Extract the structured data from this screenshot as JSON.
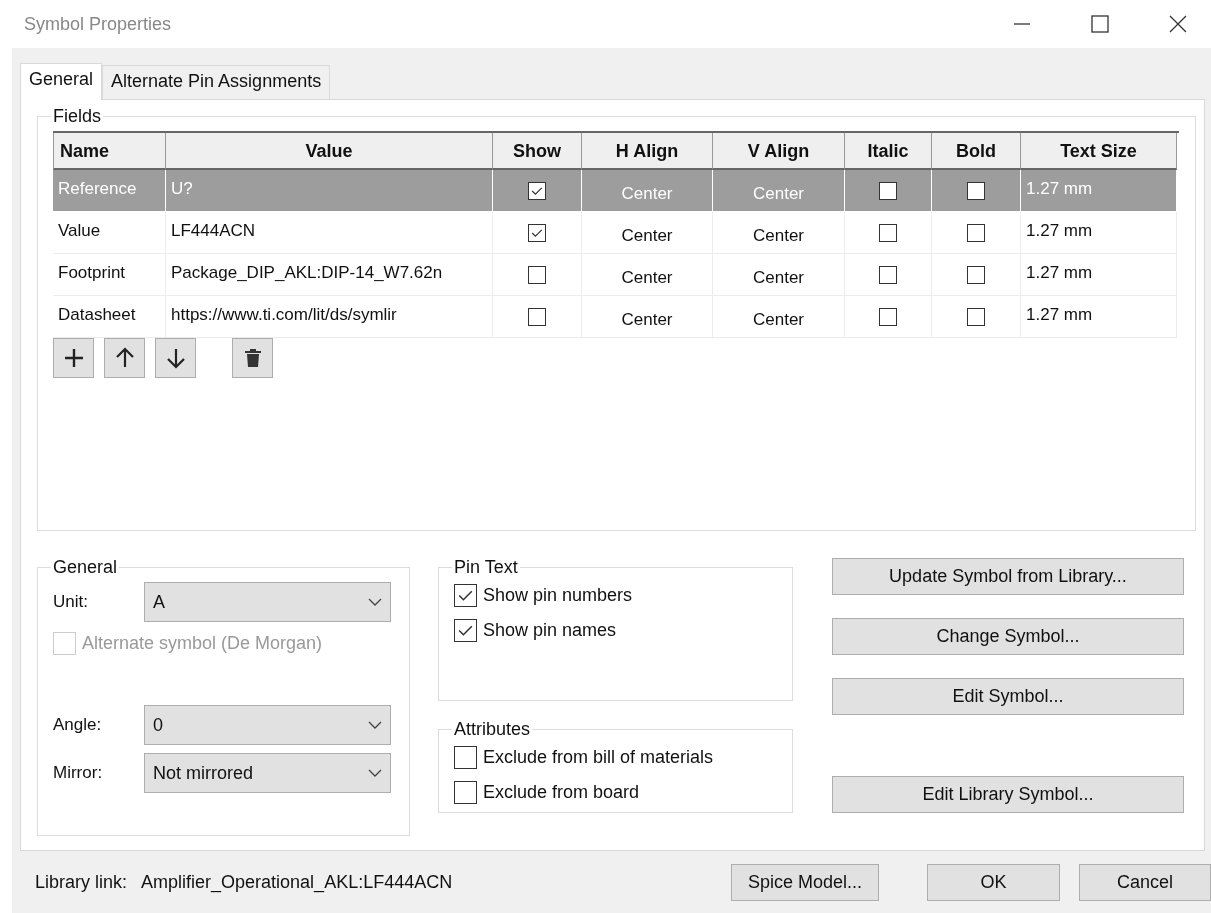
{
  "window": {
    "title": "Symbol Properties"
  },
  "tabs": [
    {
      "label": "General",
      "selected": true
    },
    {
      "label": "Alternate Pin Assignments",
      "selected": false
    }
  ],
  "fields": {
    "title": "Fields",
    "columns": [
      "Name",
      "Value",
      "Show",
      "H Align",
      "V Align",
      "Italic",
      "Bold",
      "Text Size"
    ],
    "rows": [
      {
        "name": "Reference",
        "value": "U?",
        "show": true,
        "h_align": "Center",
        "v_align": "Center",
        "italic": false,
        "bold": false,
        "text_size": "1.27 mm",
        "selected": true
      },
      {
        "name": "Value",
        "value": "LF444ACN",
        "show": true,
        "h_align": "Center",
        "v_align": "Center",
        "italic": false,
        "bold": false,
        "text_size": "1.27 mm",
        "selected": false
      },
      {
        "name": "Footprint",
        "value": "Package_DIP_AKL:DIP-14_W7.62n",
        "show": false,
        "h_align": "Center",
        "v_align": "Center",
        "italic": false,
        "bold": false,
        "text_size": "1.27 mm",
        "selected": false
      },
      {
        "name": "Datasheet",
        "value": "https://www.ti.com/lit/ds/symlir",
        "show": false,
        "h_align": "Center",
        "v_align": "Center",
        "italic": false,
        "bold": false,
        "text_size": "1.27 mm",
        "selected": false
      }
    ],
    "tools": [
      {
        "kind": "add"
      },
      {
        "kind": "up"
      },
      {
        "kind": "down"
      },
      {
        "kind": "delete"
      }
    ]
  },
  "general": {
    "title": "General",
    "unit": {
      "label": "Unit:",
      "value": "A"
    },
    "alternate": {
      "label": "Alternate symbol (De Morgan)",
      "checked": false,
      "disabled": true
    },
    "angle": {
      "label": "Angle:",
      "value": "0"
    },
    "mirror": {
      "label": "Mirror:",
      "value": "Not mirrored"
    }
  },
  "pin_text": {
    "title": "Pin Text",
    "options": [
      {
        "label": "Show pin numbers",
        "checked": true
      },
      {
        "label": "Show pin names",
        "checked": true
      }
    ]
  },
  "attributes": {
    "title": "Attributes",
    "options": [
      {
        "label": "Exclude from bill of materials",
        "checked": false
      },
      {
        "label": "Exclude from board",
        "checked": false
      }
    ]
  },
  "actions": [
    "Update Symbol from Library...",
    "Change Symbol...",
    "Edit Symbol...",
    "Edit Library Symbol..."
  ],
  "footer": {
    "library_label": "Library link:",
    "library_value": "Amplifier_Operational_AKL:LF444ACN",
    "buttons": [
      "Spice Model...",
      "OK",
      "Cancel"
    ]
  }
}
